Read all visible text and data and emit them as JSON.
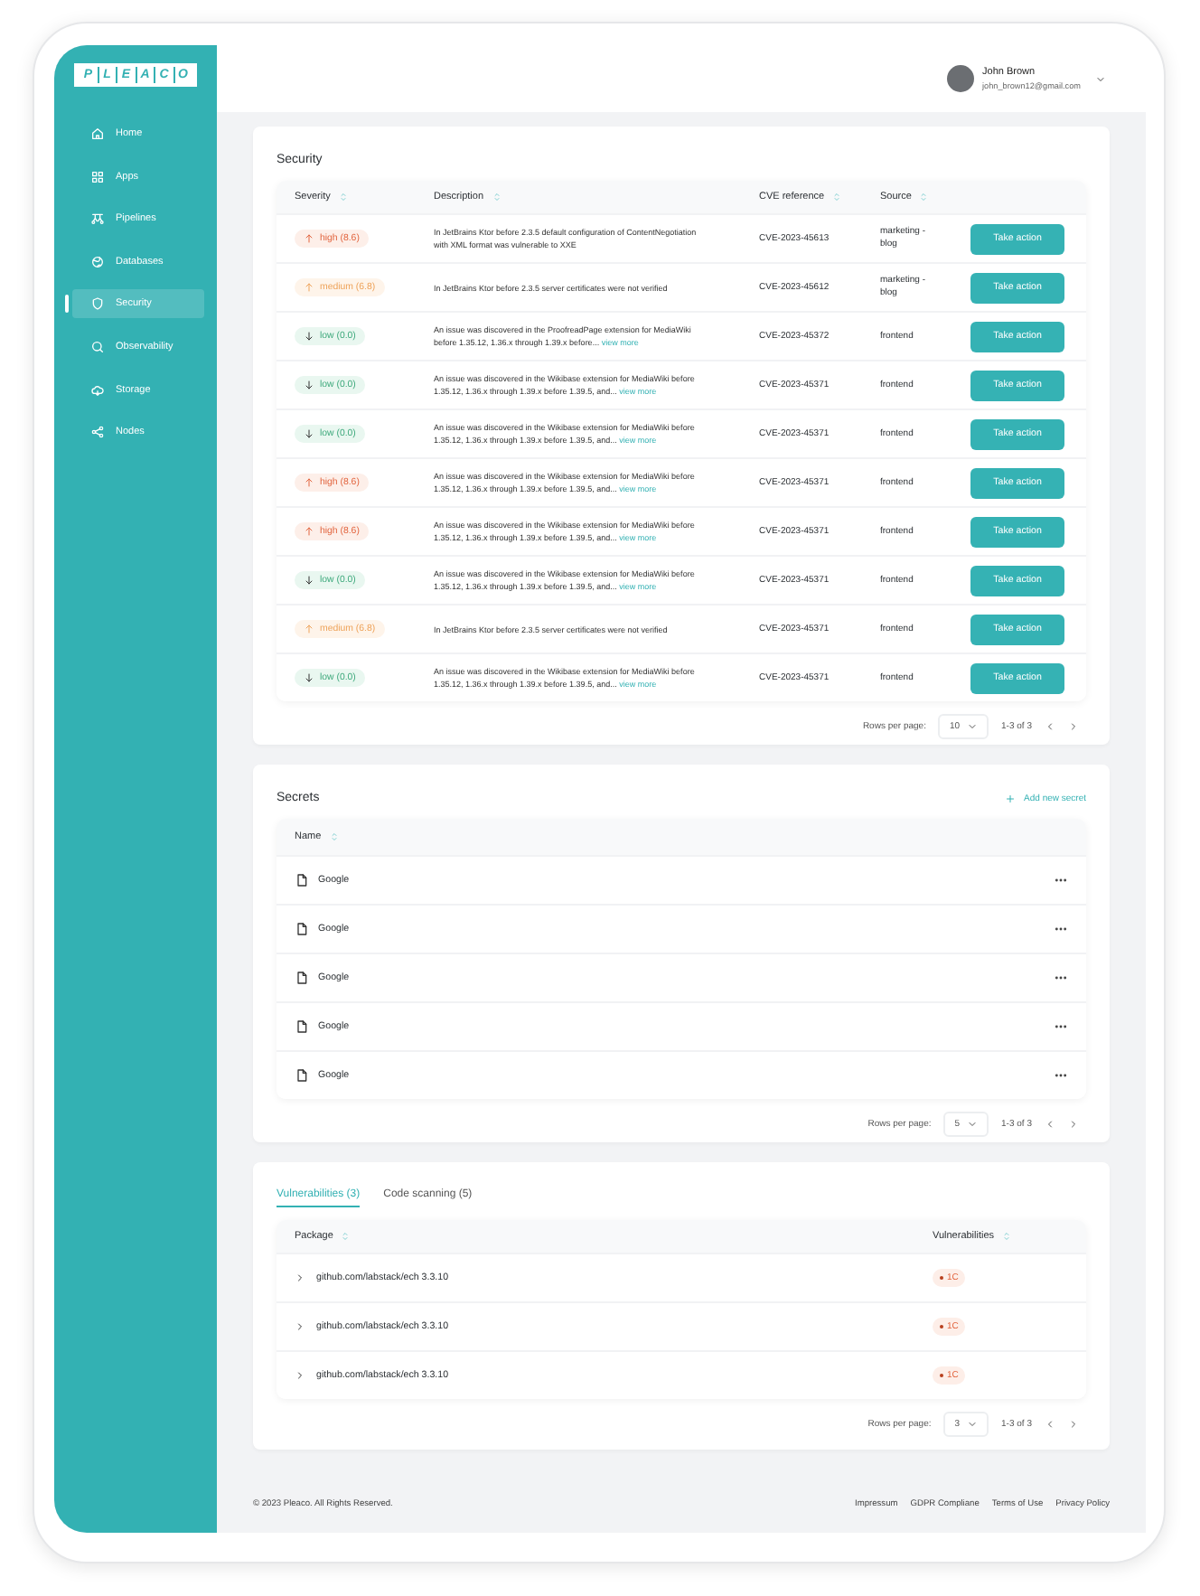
{
  "logo": [
    "P",
    "L",
    "E",
    "A",
    "C",
    "O"
  ],
  "sidebar": {
    "items": [
      {
        "label": "Home",
        "selected": false
      },
      {
        "label": "Apps",
        "selected": false
      },
      {
        "label": "Pipelines",
        "selected": false
      },
      {
        "label": "Databases",
        "selected": false
      },
      {
        "label": "Security",
        "selected": true
      },
      {
        "label": "Observability",
        "selected": false
      },
      {
        "label": "Storage",
        "selected": false
      },
      {
        "label": "Nodes",
        "selected": false
      }
    ]
  },
  "user": {
    "name": "John Brown",
    "email": "john_brown12@gmail.com"
  },
  "security": {
    "title": "Security",
    "columns": [
      "Severity",
      "Description",
      "CVE reference",
      "Source"
    ],
    "rows": [
      {
        "kind": "high",
        "severity_label": "high (8.6)",
        "description": "In JetBrains Ktor before 2.3.5 default configuration of ContentNegotiation with XML format was vulnerable to XXE",
        "cve": "CVE-2023-45613",
        "source": "marketing -blog",
        "action": "Take action"
      },
      {
        "kind": "medium",
        "severity_label": "medium (6.8)",
        "description": "In JetBrains Ktor before 2.3.5 server certificates were not verified",
        "cve": "CVE-2023-45612",
        "source": "marketing -blog",
        "action": "Take action"
      },
      {
        "kind": "low",
        "severity_label": "low (0.0)",
        "description": "An issue was discovered in the ProofreadPage extension for MediaWiki before 1.35.12, 1.36.x through 1.39.x before...",
        "more": "view more",
        "cve": "CVE-2023-45372",
        "source": "frontend",
        "action": "Take action"
      },
      {
        "kind": "low",
        "severity_label": "low (0.0)",
        "description": "An issue was discovered in the Wikibase extension for MediaWiki before 1.35.12, 1.36.x through 1.39.x before 1.39.5, and...",
        "more": "view more",
        "cve": "CVE-2023-45371",
        "source": "frontend",
        "action": "Take action"
      },
      {
        "kind": "low",
        "severity_label": "low (0.0)",
        "description": "An issue was discovered in the Wikibase extension for MediaWiki before 1.35.12, 1.36.x through 1.39.x before 1.39.5, and...",
        "more": "view more",
        "cve": "CVE-2023-45371",
        "source": "frontend",
        "action": "Take action"
      },
      {
        "kind": "high",
        "severity_label": "high (8.6)",
        "description": "An issue was discovered in the Wikibase extension for MediaWiki before 1.35.12, 1.36.x through 1.39.x before 1.39.5, and...",
        "more": "view more",
        "cve": "CVE-2023-45371",
        "source": "frontend",
        "action": "Take action"
      },
      {
        "kind": "high",
        "severity_label": "high (8.6)",
        "description": "An issue was discovered in the Wikibase extension for MediaWiki before 1.35.12, 1.36.x through 1.39.x before 1.39.5, and...",
        "more": "view more",
        "cve": "CVE-2023-45371",
        "source": "frontend",
        "action": "Take action"
      },
      {
        "kind": "low",
        "severity_label": "low (0.0)",
        "description": "An issue was discovered in the Wikibase extension for MediaWiki before 1.35.12, 1.36.x through 1.39.x before 1.39.5, and...",
        "more": "view more",
        "cve": "CVE-2023-45371",
        "source": "frontend",
        "action": "Take action"
      },
      {
        "kind": "medium",
        "severity_label": "medium (6.8)",
        "description": "In JetBrains Ktor before 2.3.5 server certificates were not verified",
        "cve": "CVE-2023-45371",
        "source": "frontend",
        "action": "Take action"
      },
      {
        "kind": "low",
        "severity_label": "low (0.0)",
        "description": "An issue was discovered in the Wikibase extension for MediaWiki before 1.35.12, 1.36.x through 1.39.x before 1.39.5, and...",
        "more": "view more",
        "cve": "CVE-2023-45371",
        "source": "frontend",
        "action": "Take action"
      }
    ],
    "pagination": {
      "rows_label": "Rows per page:",
      "rows_value": "10",
      "range": "1-3 of 3"
    }
  },
  "secrets": {
    "title": "Secrets",
    "add_label": "Add new secret",
    "columns": [
      "Name"
    ],
    "rows": [
      {
        "name": "Google"
      },
      {
        "name": "Google"
      },
      {
        "name": "Google"
      },
      {
        "name": "Google"
      },
      {
        "name": "Google"
      }
    ],
    "pagination": {
      "rows_label": "Rows per page:",
      "rows_value": "5",
      "range": "1-3 of 3"
    }
  },
  "packages": {
    "tabs": [
      {
        "label": "Vulnerabilities (3)",
        "selected": true
      },
      {
        "label": "Code scanning (5)",
        "selected": false
      }
    ],
    "columns": [
      "Package",
      "Vulnerabilities"
    ],
    "rows": [
      {
        "package": "github.com/labstack/ech 3.3.10",
        "badge": "1C"
      },
      {
        "package": "github.com/labstack/ech 3.3.10",
        "badge": "1C"
      },
      {
        "package": "github.com/labstack/ech 3.3.10",
        "badge": "1C"
      }
    ],
    "pagination": {
      "rows_label": "Rows per page:",
      "rows_value": "3",
      "range": "1-3 of 3"
    }
  },
  "footer": {
    "copyright": "© 2023 Pleaco. All Rights Reserved.",
    "links": [
      "Impressum",
      "GDPR Compliane",
      "Terms of Use",
      "Privacy Policy"
    ]
  }
}
